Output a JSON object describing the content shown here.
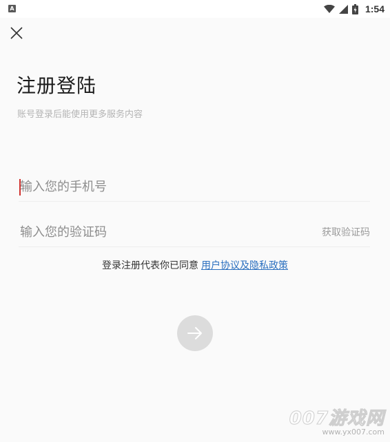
{
  "status_bar": {
    "app_icon": "A",
    "time": "1:54",
    "icons": [
      "wifi-icon",
      "signal-icon",
      "battery-icon"
    ]
  },
  "header": {
    "close_icon": "close-icon"
  },
  "title": "注册登陆",
  "subtitle": "账号登录后能使用更多服务内容",
  "phone_field": {
    "placeholder": "输入您的手机号",
    "value": ""
  },
  "code_field": {
    "placeholder": "输入您的验证码",
    "value": "",
    "get_code_label": "获取验证码"
  },
  "agreement": {
    "text": "登录注册代表你已同意",
    "link": "用户协议及隐私政策"
  },
  "next_button": {
    "icon": "arrow-right-icon"
  },
  "watermark": {
    "brand": "007游戏网",
    "url": "www.yx007.com"
  },
  "colors": {
    "link": "#2a6fbf",
    "caret": "#d0312d",
    "button": "#dcdcdc"
  }
}
